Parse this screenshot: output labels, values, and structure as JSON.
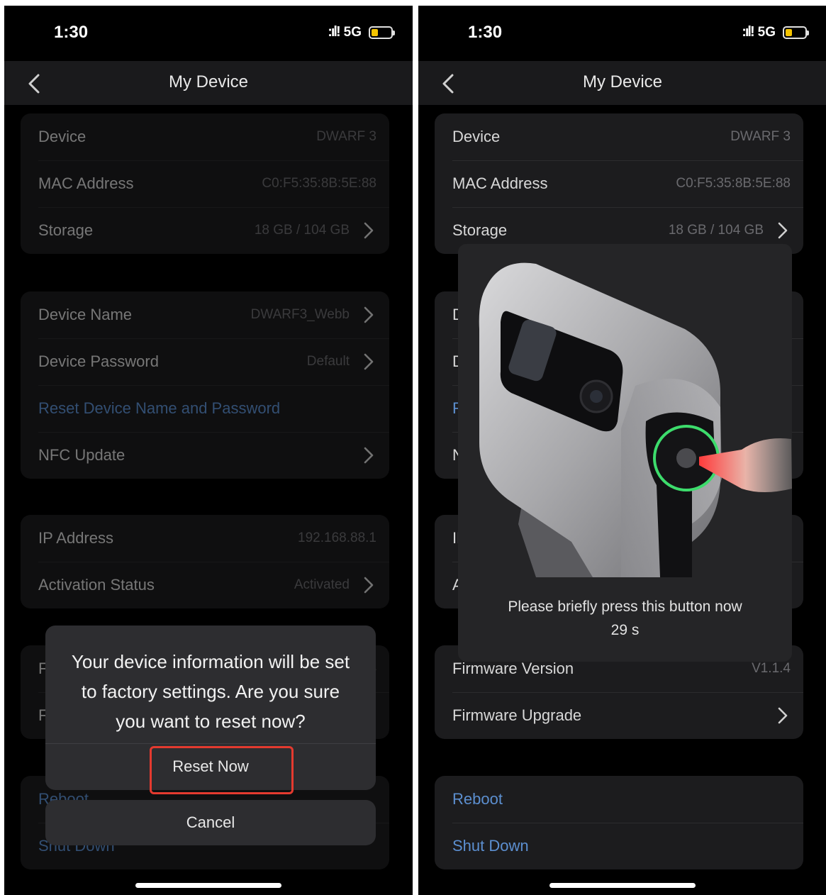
{
  "status": {
    "time": "1:30",
    "network": "5G"
  },
  "nav": {
    "title": "My Device"
  },
  "device_info": {
    "device_label": "Device",
    "device_value": "DWARF 3",
    "mac_label": "MAC Address",
    "mac_value": "C0:F5:35:8B:5E:88",
    "storage_label": "Storage",
    "storage_value": "18 GB / 104 GB"
  },
  "identity": {
    "name_label": "Device Name",
    "name_value": "DWARF3_Webb",
    "password_label": "Device Password",
    "password_value": "Default",
    "reset_label": "Reset Device Name and Password",
    "nfc_label": "NFC Update"
  },
  "network": {
    "ip_label": "IP Address",
    "ip_value": "192.168.88.1",
    "activation_label": "Activation Status",
    "activation_value": "Activated"
  },
  "firmware": {
    "version_label": "Firmware Version",
    "version_value": "V1.1.4",
    "upgrade_label": "Firmware Upgrade"
  },
  "power": {
    "reboot_label": "Reboot",
    "shutdown_label": "Shut Down"
  },
  "reset_alert": {
    "message": "Your device information will be set to factory settings. Are you sure you want to reset now?",
    "confirm_label": "Reset Now",
    "cancel_label": "Cancel"
  },
  "press_prompt": {
    "message": "Please briefly press this button now",
    "countdown": "29 s"
  },
  "colors": {
    "link_blue": "#5c8fd0",
    "highlight_red": "#e43a2f",
    "ring_green": "#3ddc6c",
    "battery_yellow": "#f5c400"
  }
}
